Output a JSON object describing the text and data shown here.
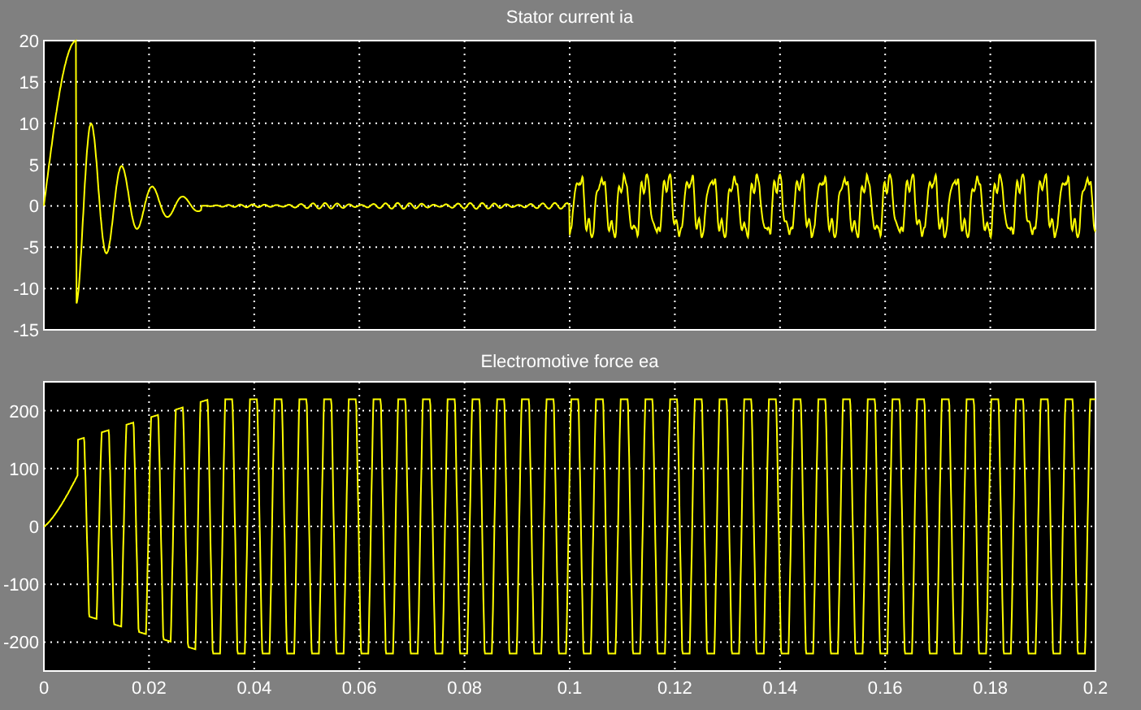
{
  "plots": [
    {
      "title": "Stator current ia",
      "kind": "current",
      "yticks": [
        "20",
        "15",
        "10",
        "5",
        "0",
        "-5",
        "-10",
        "-15"
      ]
    },
    {
      "title": "Electromotive force ea",
      "kind": "emf",
      "yticks": [
        "200",
        "100",
        "0",
        "-100",
        "-200"
      ],
      "xticks": [
        "0",
        "0.02",
        "0.04",
        "0.06",
        "0.08",
        "0.1",
        "0.12",
        "0.14",
        "0.16",
        "0.18",
        "0.2"
      ]
    }
  ]
}
